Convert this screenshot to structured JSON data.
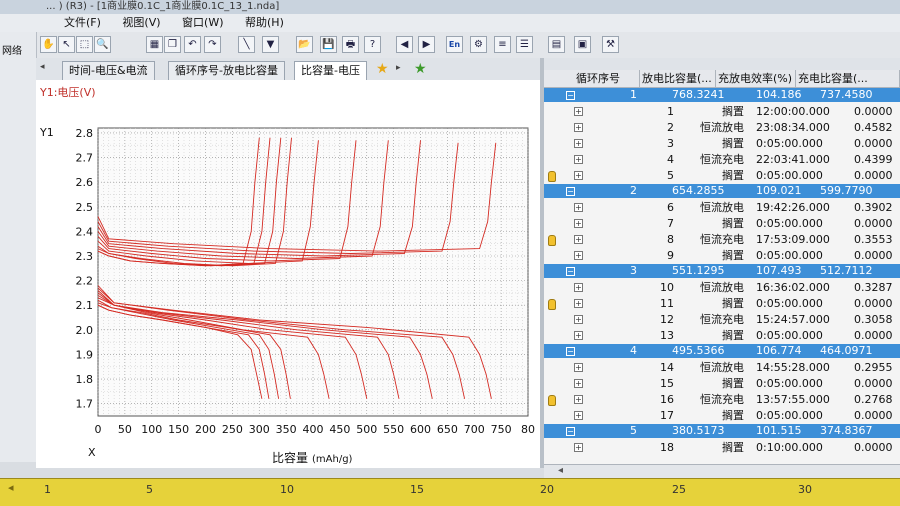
{
  "app": {
    "title": "... ) (R3) - [1商业膜0.1C_1商业膜0.1C_13_1.nda]",
    "menu": [
      "文件(F)",
      "视图(V)",
      "窗口(W)",
      "帮助(H)"
    ],
    "left_label": "网络"
  },
  "tabs": [
    "时间-电压&电流",
    "循环序号-放电比容量",
    "比容量-电压"
  ],
  "chart": {
    "title": "Y1:电压(V)",
    "y_axis_label": "Y1",
    "x_origin_label": "X",
    "xlabel": "比容量",
    "xlabel_unit": "(mAh/g)",
    "y_ticks": [
      "2.8",
      "2.7",
      "2.6",
      "2.5",
      "2.4",
      "2.3",
      "2.2",
      "2.1",
      "2.0",
      "1.9",
      "1.8",
      "1.7"
    ],
    "x_ticks": [
      "0",
      "50",
      "100",
      "150",
      "200",
      "250",
      "300",
      "350",
      "400",
      "450",
      "500",
      "550",
      "600",
      "650",
      "700",
      "750",
      "80"
    ]
  },
  "chart_data": {
    "type": "line",
    "title": "Y1:电压(V)",
    "xlabel": "比容量(mAh/g)",
    "ylabel": "Y1",
    "xlim": [
      0,
      800
    ],
    "ylim": [
      1.65,
      2.82
    ],
    "grid": true,
    "line_color": "#d42a22",
    "series": [
      {
        "values": [
          [
            0,
            2.1
          ],
          [
            20,
            2.08
          ],
          [
            60,
            2.06
          ],
          [
            120,
            2.04
          ],
          [
            200,
            2.01
          ],
          [
            260,
            1.98
          ],
          [
            285,
            1.92
          ],
          [
            295,
            1.82
          ],
          [
            305,
            1.72
          ]
        ]
      },
      {
        "values": [
          [
            0,
            2.1
          ],
          [
            20,
            2.08
          ],
          [
            60,
            2.06
          ],
          [
            120,
            2.04
          ],
          [
            200,
            2.01
          ],
          [
            280,
            1.98
          ],
          [
            300,
            1.92
          ],
          [
            310,
            1.82
          ],
          [
            318,
            1.72
          ]
        ]
      },
      {
        "values": [
          [
            0,
            2.11
          ],
          [
            25,
            2.09
          ],
          [
            70,
            2.07
          ],
          [
            140,
            2.04
          ],
          [
            220,
            2.01
          ],
          [
            300,
            1.98
          ],
          [
            318,
            1.92
          ],
          [
            328,
            1.82
          ],
          [
            336,
            1.72
          ]
        ]
      },
      {
        "values": [
          [
            0,
            2.12
          ],
          [
            25,
            2.09
          ],
          [
            80,
            2.07
          ],
          [
            150,
            2.04
          ],
          [
            240,
            2.01
          ],
          [
            320,
            1.98
          ],
          [
            340,
            1.92
          ],
          [
            350,
            1.82
          ],
          [
            358,
            1.72
          ]
        ]
      },
      {
        "values": [
          [
            0,
            2.13
          ],
          [
            30,
            2.1
          ],
          [
            90,
            2.07
          ],
          [
            170,
            2.04
          ],
          [
            270,
            2.0
          ],
          [
            390,
            1.97
          ],
          [
            410,
            1.9
          ],
          [
            420,
            1.82
          ],
          [
            430,
            1.72
          ]
        ]
      },
      {
        "values": [
          [
            0,
            2.14
          ],
          [
            30,
            2.1
          ],
          [
            100,
            2.07
          ],
          [
            200,
            2.04
          ],
          [
            320,
            2.0
          ],
          [
            460,
            1.97
          ],
          [
            480,
            1.9
          ],
          [
            490,
            1.82
          ],
          [
            500,
            1.72
          ]
        ]
      },
      {
        "values": [
          [
            0,
            2.15
          ],
          [
            30,
            2.1
          ],
          [
            110,
            2.07
          ],
          [
            230,
            2.04
          ],
          [
            370,
            2.0
          ],
          [
            520,
            1.97
          ],
          [
            540,
            1.9
          ],
          [
            550,
            1.82
          ],
          [
            560,
            1.72
          ]
        ]
      },
      {
        "values": [
          [
            0,
            2.16
          ],
          [
            30,
            2.1
          ],
          [
            120,
            2.07
          ],
          [
            260,
            2.04
          ],
          [
            420,
            2.0
          ],
          [
            580,
            1.97
          ],
          [
            600,
            1.9
          ],
          [
            612,
            1.82
          ],
          [
            622,
            1.72
          ]
        ]
      },
      {
        "values": [
          [
            0,
            2.17
          ],
          [
            30,
            2.11
          ],
          [
            130,
            2.08
          ],
          [
            280,
            2.04
          ],
          [
            460,
            2.0
          ],
          [
            640,
            1.97
          ],
          [
            660,
            1.9
          ],
          [
            672,
            1.82
          ],
          [
            682,
            1.72
          ]
        ]
      },
      {
        "values": [
          [
            0,
            2.18
          ],
          [
            30,
            2.11
          ],
          [
            140,
            2.08
          ],
          [
            300,
            2.04
          ],
          [
            500,
            2.01
          ],
          [
            690,
            1.97
          ],
          [
            710,
            1.9
          ],
          [
            722,
            1.82
          ],
          [
            732,
            1.72
          ]
        ]
      },
      {
        "values": [
          [
            0,
            2.32
          ],
          [
            20,
            2.3
          ],
          [
            60,
            2.28
          ],
          [
            120,
            2.27
          ],
          [
            200,
            2.26
          ],
          [
            270,
            2.27
          ],
          [
            285,
            2.4
          ],
          [
            292,
            2.6
          ],
          [
            300,
            2.78
          ]
        ]
      },
      {
        "values": [
          [
            0,
            2.32
          ],
          [
            20,
            2.3
          ],
          [
            60,
            2.28
          ],
          [
            120,
            2.27
          ],
          [
            210,
            2.26
          ],
          [
            290,
            2.27
          ],
          [
            305,
            2.4
          ],
          [
            312,
            2.6
          ],
          [
            320,
            2.78
          ]
        ]
      },
      {
        "values": [
          [
            0,
            2.33
          ],
          [
            20,
            2.31
          ],
          [
            70,
            2.29
          ],
          [
            140,
            2.27
          ],
          [
            230,
            2.26
          ],
          [
            310,
            2.27
          ],
          [
            325,
            2.4
          ],
          [
            332,
            2.6
          ],
          [
            340,
            2.78
          ]
        ]
      },
      {
        "values": [
          [
            0,
            2.34
          ],
          [
            20,
            2.31
          ],
          [
            80,
            2.29
          ],
          [
            160,
            2.27
          ],
          [
            250,
            2.26
          ],
          [
            330,
            2.27
          ],
          [
            345,
            2.4
          ],
          [
            352,
            2.6
          ],
          [
            360,
            2.78
          ]
        ]
      },
      {
        "values": [
          [
            0,
            2.36
          ],
          [
            20,
            2.32
          ],
          [
            90,
            2.3
          ],
          [
            180,
            2.28
          ],
          [
            280,
            2.27
          ],
          [
            380,
            2.28
          ],
          [
            395,
            2.42
          ],
          [
            402,
            2.6
          ],
          [
            410,
            2.77
          ]
        ]
      },
      {
        "values": [
          [
            0,
            2.38
          ],
          [
            20,
            2.33
          ],
          [
            100,
            2.31
          ],
          [
            200,
            2.29
          ],
          [
            320,
            2.28
          ],
          [
            450,
            2.29
          ],
          [
            465,
            2.42
          ],
          [
            472,
            2.6
          ],
          [
            480,
            2.77
          ]
        ]
      },
      {
        "values": [
          [
            0,
            2.4
          ],
          [
            20,
            2.34
          ],
          [
            110,
            2.32
          ],
          [
            230,
            2.3
          ],
          [
            370,
            2.29
          ],
          [
            510,
            2.3
          ],
          [
            525,
            2.42
          ],
          [
            532,
            2.6
          ],
          [
            540,
            2.77
          ]
        ]
      },
      {
        "values": [
          [
            0,
            2.42
          ],
          [
            20,
            2.35
          ],
          [
            120,
            2.33
          ],
          [
            260,
            2.31
          ],
          [
            420,
            2.3
          ],
          [
            570,
            2.31
          ],
          [
            585,
            2.42
          ],
          [
            592,
            2.6
          ],
          [
            600,
            2.77
          ]
        ]
      },
      {
        "values": [
          [
            0,
            2.44
          ],
          [
            20,
            2.36
          ],
          [
            130,
            2.34
          ],
          [
            290,
            2.32
          ],
          [
            470,
            2.31
          ],
          [
            640,
            2.32
          ],
          [
            655,
            2.44
          ],
          [
            662,
            2.6
          ],
          [
            670,
            2.76
          ]
        ]
      },
      {
        "values": [
          [
            0,
            2.46
          ],
          [
            20,
            2.37
          ],
          [
            140,
            2.35
          ],
          [
            320,
            2.33
          ],
          [
            520,
            2.32
          ],
          [
            710,
            2.33
          ],
          [
            725,
            2.44
          ],
          [
            732,
            2.6
          ],
          [
            740,
            2.76
          ]
        ]
      }
    ]
  },
  "table": {
    "headers": [
      "循环序号",
      "放电比容量(...",
      "充放电效率(%)",
      "充电比容量(..."
    ],
    "groups": [
      {
        "cycle": "1",
        "discharge": "768.3241",
        "efficiency": "104.186",
        "charge": "737.4580",
        "steps": [
          {
            "no": "1",
            "type": "搁置",
            "time": "12:00:00.000",
            "value": "0.0000"
          },
          {
            "no": "2",
            "type": "恒流放电",
            "time": "23:08:34.000",
            "value": "0.4582"
          },
          {
            "no": "3",
            "type": "搁置",
            "time": "0:05:00.000",
            "value": "0.0000"
          },
          {
            "no": "4",
            "type": "恒流充电",
            "time": "22:03:41.000",
            "value": "0.4399"
          },
          {
            "no": "5",
            "type": "搁置",
            "time": "0:05:00.000",
            "value": "0.0000"
          }
        ]
      },
      {
        "cycle": "2",
        "discharge": "654.2855",
        "efficiency": "109.021",
        "charge": "599.7790",
        "steps": [
          {
            "no": "6",
            "type": "恒流放电",
            "time": "19:42:26.000",
            "value": "0.3902"
          },
          {
            "no": "7",
            "type": "搁置",
            "time": "0:05:00.000",
            "value": "0.0000"
          },
          {
            "no": "8",
            "type": "恒流充电",
            "time": "17:53:09.000",
            "value": "0.3553"
          },
          {
            "no": "9",
            "type": "搁置",
            "time": "0:05:00.000",
            "value": "0.0000"
          }
        ]
      },
      {
        "cycle": "3",
        "discharge": "551.1295",
        "efficiency": "107.493",
        "charge": "512.7112",
        "steps": [
          {
            "no": "10",
            "type": "恒流放电",
            "time": "16:36:02.000",
            "value": "0.3287"
          },
          {
            "no": "11",
            "type": "搁置",
            "time": "0:05:00.000",
            "value": "0.0000"
          },
          {
            "no": "12",
            "type": "恒流充电",
            "time": "15:24:57.000",
            "value": "0.3058"
          },
          {
            "no": "13",
            "type": "搁置",
            "time": "0:05:00.000",
            "value": "0.0000"
          }
        ]
      },
      {
        "cycle": "4",
        "discharge": "495.5366",
        "efficiency": "106.774",
        "charge": "464.0971",
        "steps": [
          {
            "no": "14",
            "type": "恒流放电",
            "time": "14:55:28.000",
            "value": "0.2955"
          },
          {
            "no": "15",
            "type": "搁置",
            "time": "0:05:00.000",
            "value": "0.0000"
          },
          {
            "no": "16",
            "type": "恒流充电",
            "time": "13:57:55.000",
            "value": "0.2768"
          },
          {
            "no": "17",
            "type": "搁置",
            "time": "0:05:00.000",
            "value": "0.0000"
          }
        ]
      },
      {
        "cycle": "5",
        "discharge": "380.5173",
        "efficiency": "101.515",
        "charge": "374.8367",
        "steps": [
          {
            "no": "18",
            "type": "搁置",
            "time": "0:10:00.000",
            "value": "0.0000"
          }
        ]
      }
    ]
  },
  "ruler": [
    "1",
    "5",
    "10",
    "15",
    "20",
    "25",
    "30"
  ],
  "icons": [
    "hand-icon",
    "pointer-icon",
    "zoom-box-icon",
    "zoom-icon",
    "grid-icon",
    "copy-icon",
    "undo-icon",
    "redo-icon",
    "line-tool-icon",
    "filter-icon",
    "open-folder-icon",
    "save-icon",
    "print-icon",
    "help-icon",
    "prev-icon",
    "next-icon",
    "language-icon",
    "settings-icon",
    "export-icon",
    "table-view-icon",
    "report-icon",
    "export-image-icon",
    "chart-config-icon"
  ]
}
